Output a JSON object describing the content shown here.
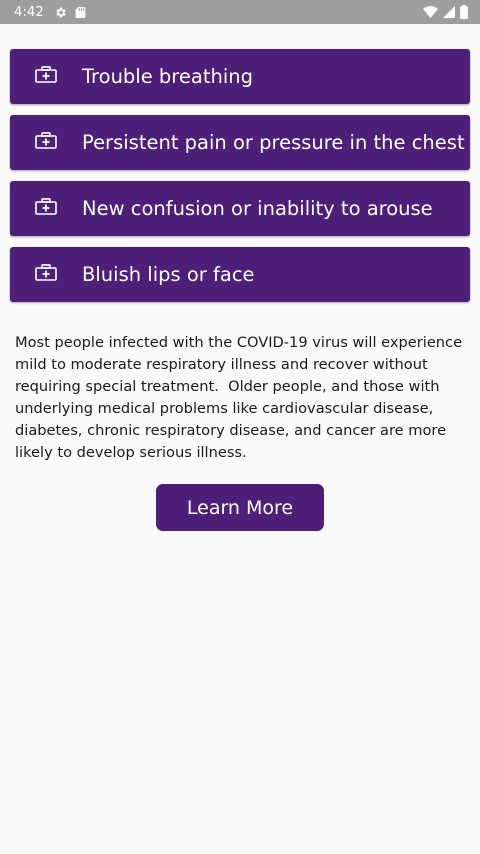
{
  "status_bar": {
    "time": "4:42",
    "icons": [
      "settings-gear-icon",
      "sd-card-icon",
      "wifi-icon",
      "signal-icon",
      "battery-icon"
    ]
  },
  "symptoms": [
    {
      "label": "Trouble breathing",
      "icon": "medical-kit-icon"
    },
    {
      "label": "Persistent pain or pressure in the chest",
      "icon": "medical-kit-icon"
    },
    {
      "label": "New confusion or inability to arouse",
      "icon": "medical-kit-icon"
    },
    {
      "label": "Bluish lips or face",
      "icon": "medical-kit-icon"
    }
  ],
  "info_text": "Most people infected with the COVID-19 virus will experience mild to moderate respiratory illness and recover without requiring special treatment.  Older people, and those with underlying medical problems like cardiovascular disease, diabetes, chronic respiratory disease, and cancer are more likely to develop serious illness.",
  "learn_more_label": "Learn More",
  "colors": {
    "accent": "#4e1f79",
    "status_bar": "#9e9e9e",
    "background": "#fafafa"
  }
}
